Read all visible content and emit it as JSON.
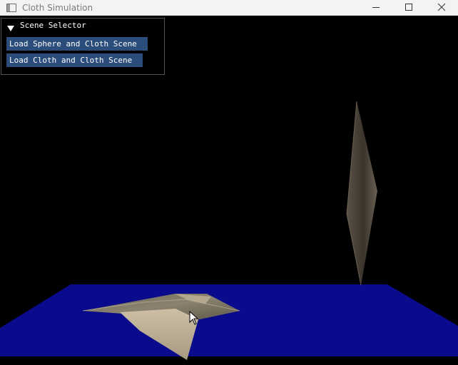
{
  "window": {
    "title": "Cloth Simulation",
    "icon": "app-window-icon",
    "controls": [
      "minimize-icon",
      "maximize-icon",
      "close-icon"
    ]
  },
  "scene_selector": {
    "header": "Scene Selector",
    "expanded": true,
    "buttons": [
      {
        "label": "Load Sphere and Cloth Scene"
      },
      {
        "label": "Load Cloth and Cloth Scene"
      }
    ]
  },
  "colors": {
    "background": "#000000",
    "floor": "#0a0a8c",
    "button": "#2a4d7c",
    "cloth": "#a9a08f"
  }
}
